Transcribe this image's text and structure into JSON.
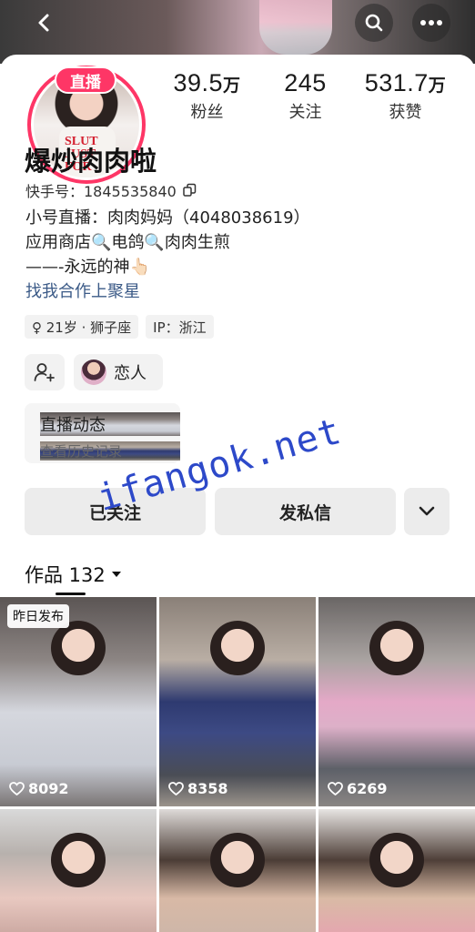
{
  "header": {
    "back_icon": "chevron-left-icon",
    "search_icon": "search-icon",
    "more_icon": "more-horizontal-icon"
  },
  "profile": {
    "live_badge": "直播",
    "avatar_shirt_text": "SLUT JUST FOR",
    "name": "爆炒肉肉啦",
    "kuaishou_id": "快手号：1845535840",
    "bio_lines": [
      "小号直播：肉肉妈妈（4048038619）",
      "应用商店🔍电鸽🔍肉肉生煎",
      "——-永远的神👆🏻"
    ],
    "bio_link": "找我合作上聚星",
    "tags": [
      "♀ 21岁 · 狮子座",
      "IP：浙江"
    ],
    "lover_label": "恋人"
  },
  "stats": {
    "fans": {
      "num": "39.5",
      "unit": "万",
      "label": "粉丝"
    },
    "following": {
      "num": "245",
      "unit": "",
      "label": "关注"
    },
    "likes": {
      "num": "531.7",
      "unit": "万",
      "label": "获赞"
    }
  },
  "live_card": {
    "title": "直播动态",
    "subtitle": "查看历史记录"
  },
  "actions": {
    "followed": "已关注",
    "message": "发私信"
  },
  "watermark": "ifangok.net",
  "works": {
    "label": "作品 132",
    "items": [
      {
        "badge": "昨日发布",
        "likes": "8092"
      },
      {
        "badge": "",
        "likes": "8358"
      },
      {
        "badge": "",
        "likes": "6269"
      },
      {
        "badge": "",
        "likes": ""
      },
      {
        "badge": "",
        "likes": ""
      },
      {
        "badge": "",
        "likes": ""
      }
    ]
  },
  "colors": {
    "accent": "#fe3666",
    "link": "#3b5a87",
    "button_bg": "#ececec"
  }
}
